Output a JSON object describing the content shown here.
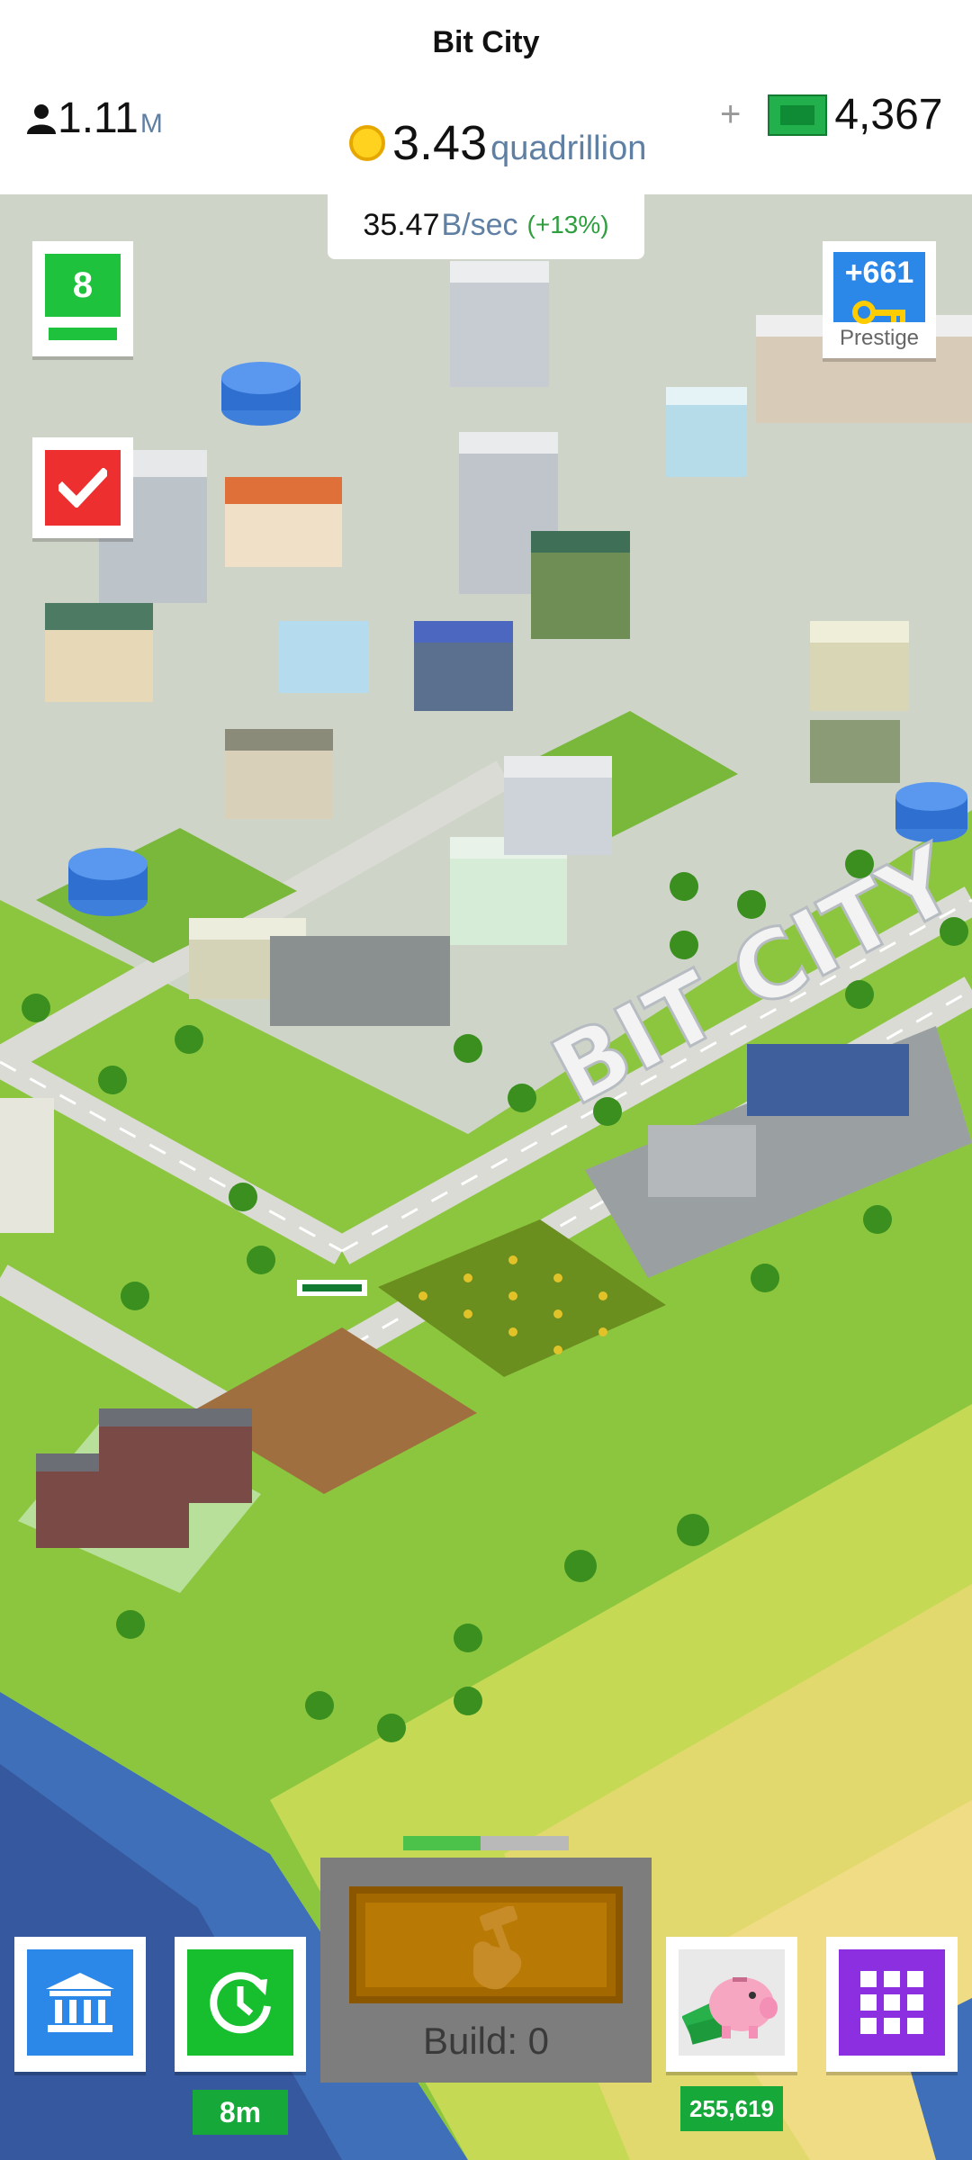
{
  "header": {
    "title": "Bit City",
    "population": {
      "value": "1.11",
      "unit": "M"
    },
    "coins": {
      "value": "3.43",
      "unit": "quadrillion"
    },
    "cash": {
      "plus": "+",
      "value": "4,367"
    },
    "income": {
      "value": "35.47",
      "unit": "B/sec",
      "bonus": "(+13%)"
    }
  },
  "side": {
    "level": "8",
    "prestige": {
      "value": "+661",
      "label": "Prestige"
    }
  },
  "map": {
    "sign": "BIT CITY"
  },
  "build": {
    "label": "Build: 0",
    "progress": 0.47
  },
  "bottom": {
    "boost_timer": "8m",
    "piggy_amount": "255,619"
  },
  "icons": {
    "population": "person-icon",
    "coins": "coin-icon",
    "cash": "cash-icon",
    "tasks": "checkmark-icon",
    "prestige": "key-icon",
    "camera": "camera-icon",
    "bank": "bank-icon",
    "boost": "clock-refresh-icon",
    "piggy": "piggy-bank-icon",
    "grid": "grid-icon",
    "build": "hammer-hand-icon"
  },
  "colors": {
    "level_green": "#1fc23c",
    "tasks_red": "#ee2f2f",
    "prestige_blue": "#2b87e8",
    "grass": "#8cc63f",
    "sea": "#3a74c2",
    "sand": "#e9d278"
  }
}
